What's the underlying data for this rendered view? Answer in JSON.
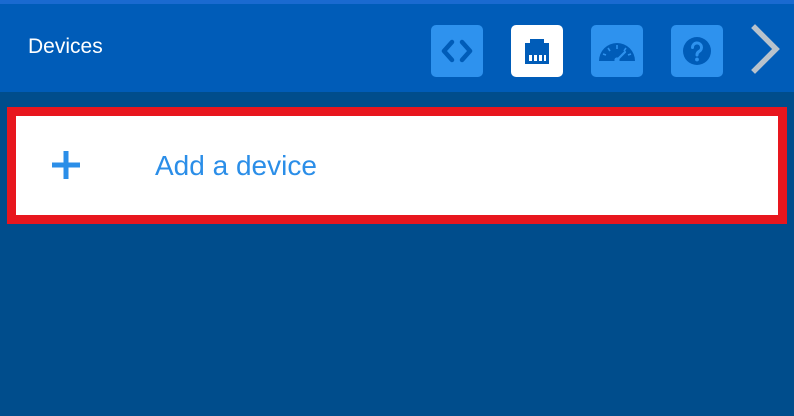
{
  "header": {
    "title": "Devices",
    "buttons": [
      {
        "icon": "code-icon",
        "active": false
      },
      {
        "icon": "ethernet-icon",
        "active": true
      },
      {
        "icon": "gauge-icon",
        "active": false
      },
      {
        "icon": "help-icon",
        "active": false
      }
    ],
    "next_icon": "chevron-right-icon"
  },
  "main": {
    "add_device_label": "Add a device",
    "add_icon": "plus-icon"
  },
  "colors": {
    "header_bg": "#005cb8",
    "page_bg": "#004d8c",
    "button_bg": "#2e92ee",
    "accent": "#2b8ee8",
    "highlight": "#e8161e"
  }
}
